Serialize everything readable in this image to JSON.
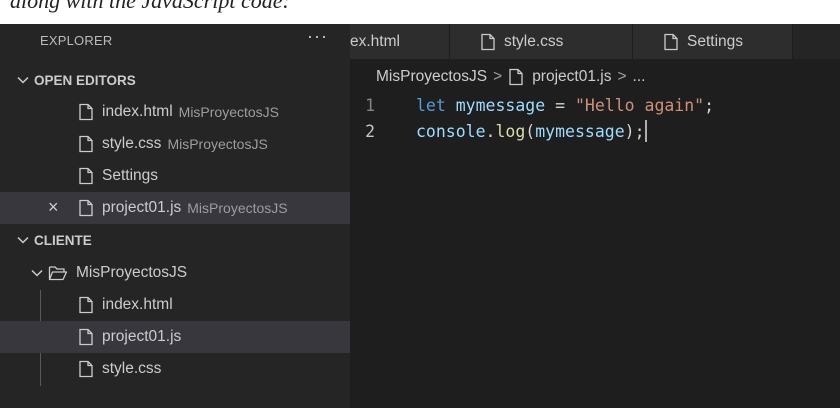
{
  "caption": {
    "text": "along with the JavaScript code:"
  },
  "explorer": {
    "title": "EXPLORER",
    "more": "···",
    "open_editors": {
      "header": "OPEN EDITORS",
      "items": [
        {
          "name": "index.html",
          "desc": "MisProyectosJS"
        },
        {
          "name": "style.css",
          "desc": "MisProyectosJS"
        },
        {
          "name": "Settings",
          "desc": ""
        },
        {
          "name": "project01.js",
          "desc": "MisProyectosJS",
          "close": "×"
        }
      ]
    },
    "workspace": {
      "header": "CLIENTE",
      "folder": "MisProyectosJS",
      "files": [
        "index.html",
        "project01.js",
        "style.css"
      ]
    }
  },
  "tabs": [
    {
      "label": "ex.html"
    },
    {
      "label": "style.css"
    },
    {
      "label": "Settings"
    }
  ],
  "breadcrumb": {
    "folder": "MisProyectosJS",
    "sep": ">",
    "file": "project01.js",
    "tail": "..."
  },
  "code": {
    "lines": [
      {
        "number": "1",
        "kw": "let",
        "var": "mymessage",
        "op": " = ",
        "str": "\"Hello again\"",
        "end": ";"
      },
      {
        "number": "2",
        "obj": "console",
        "dot": ".",
        "fn": "log",
        "open": "(",
        "arg": "mymessage",
        "close": ");"
      }
    ]
  },
  "colors": {
    "sidebar_bg": "#252526",
    "editor_bg": "#1e1e1e",
    "selected_row": "#37373d",
    "keyword": "#569cd6",
    "variable": "#9cdcfe",
    "string": "#ce9178",
    "function": "#dcdcaa"
  }
}
